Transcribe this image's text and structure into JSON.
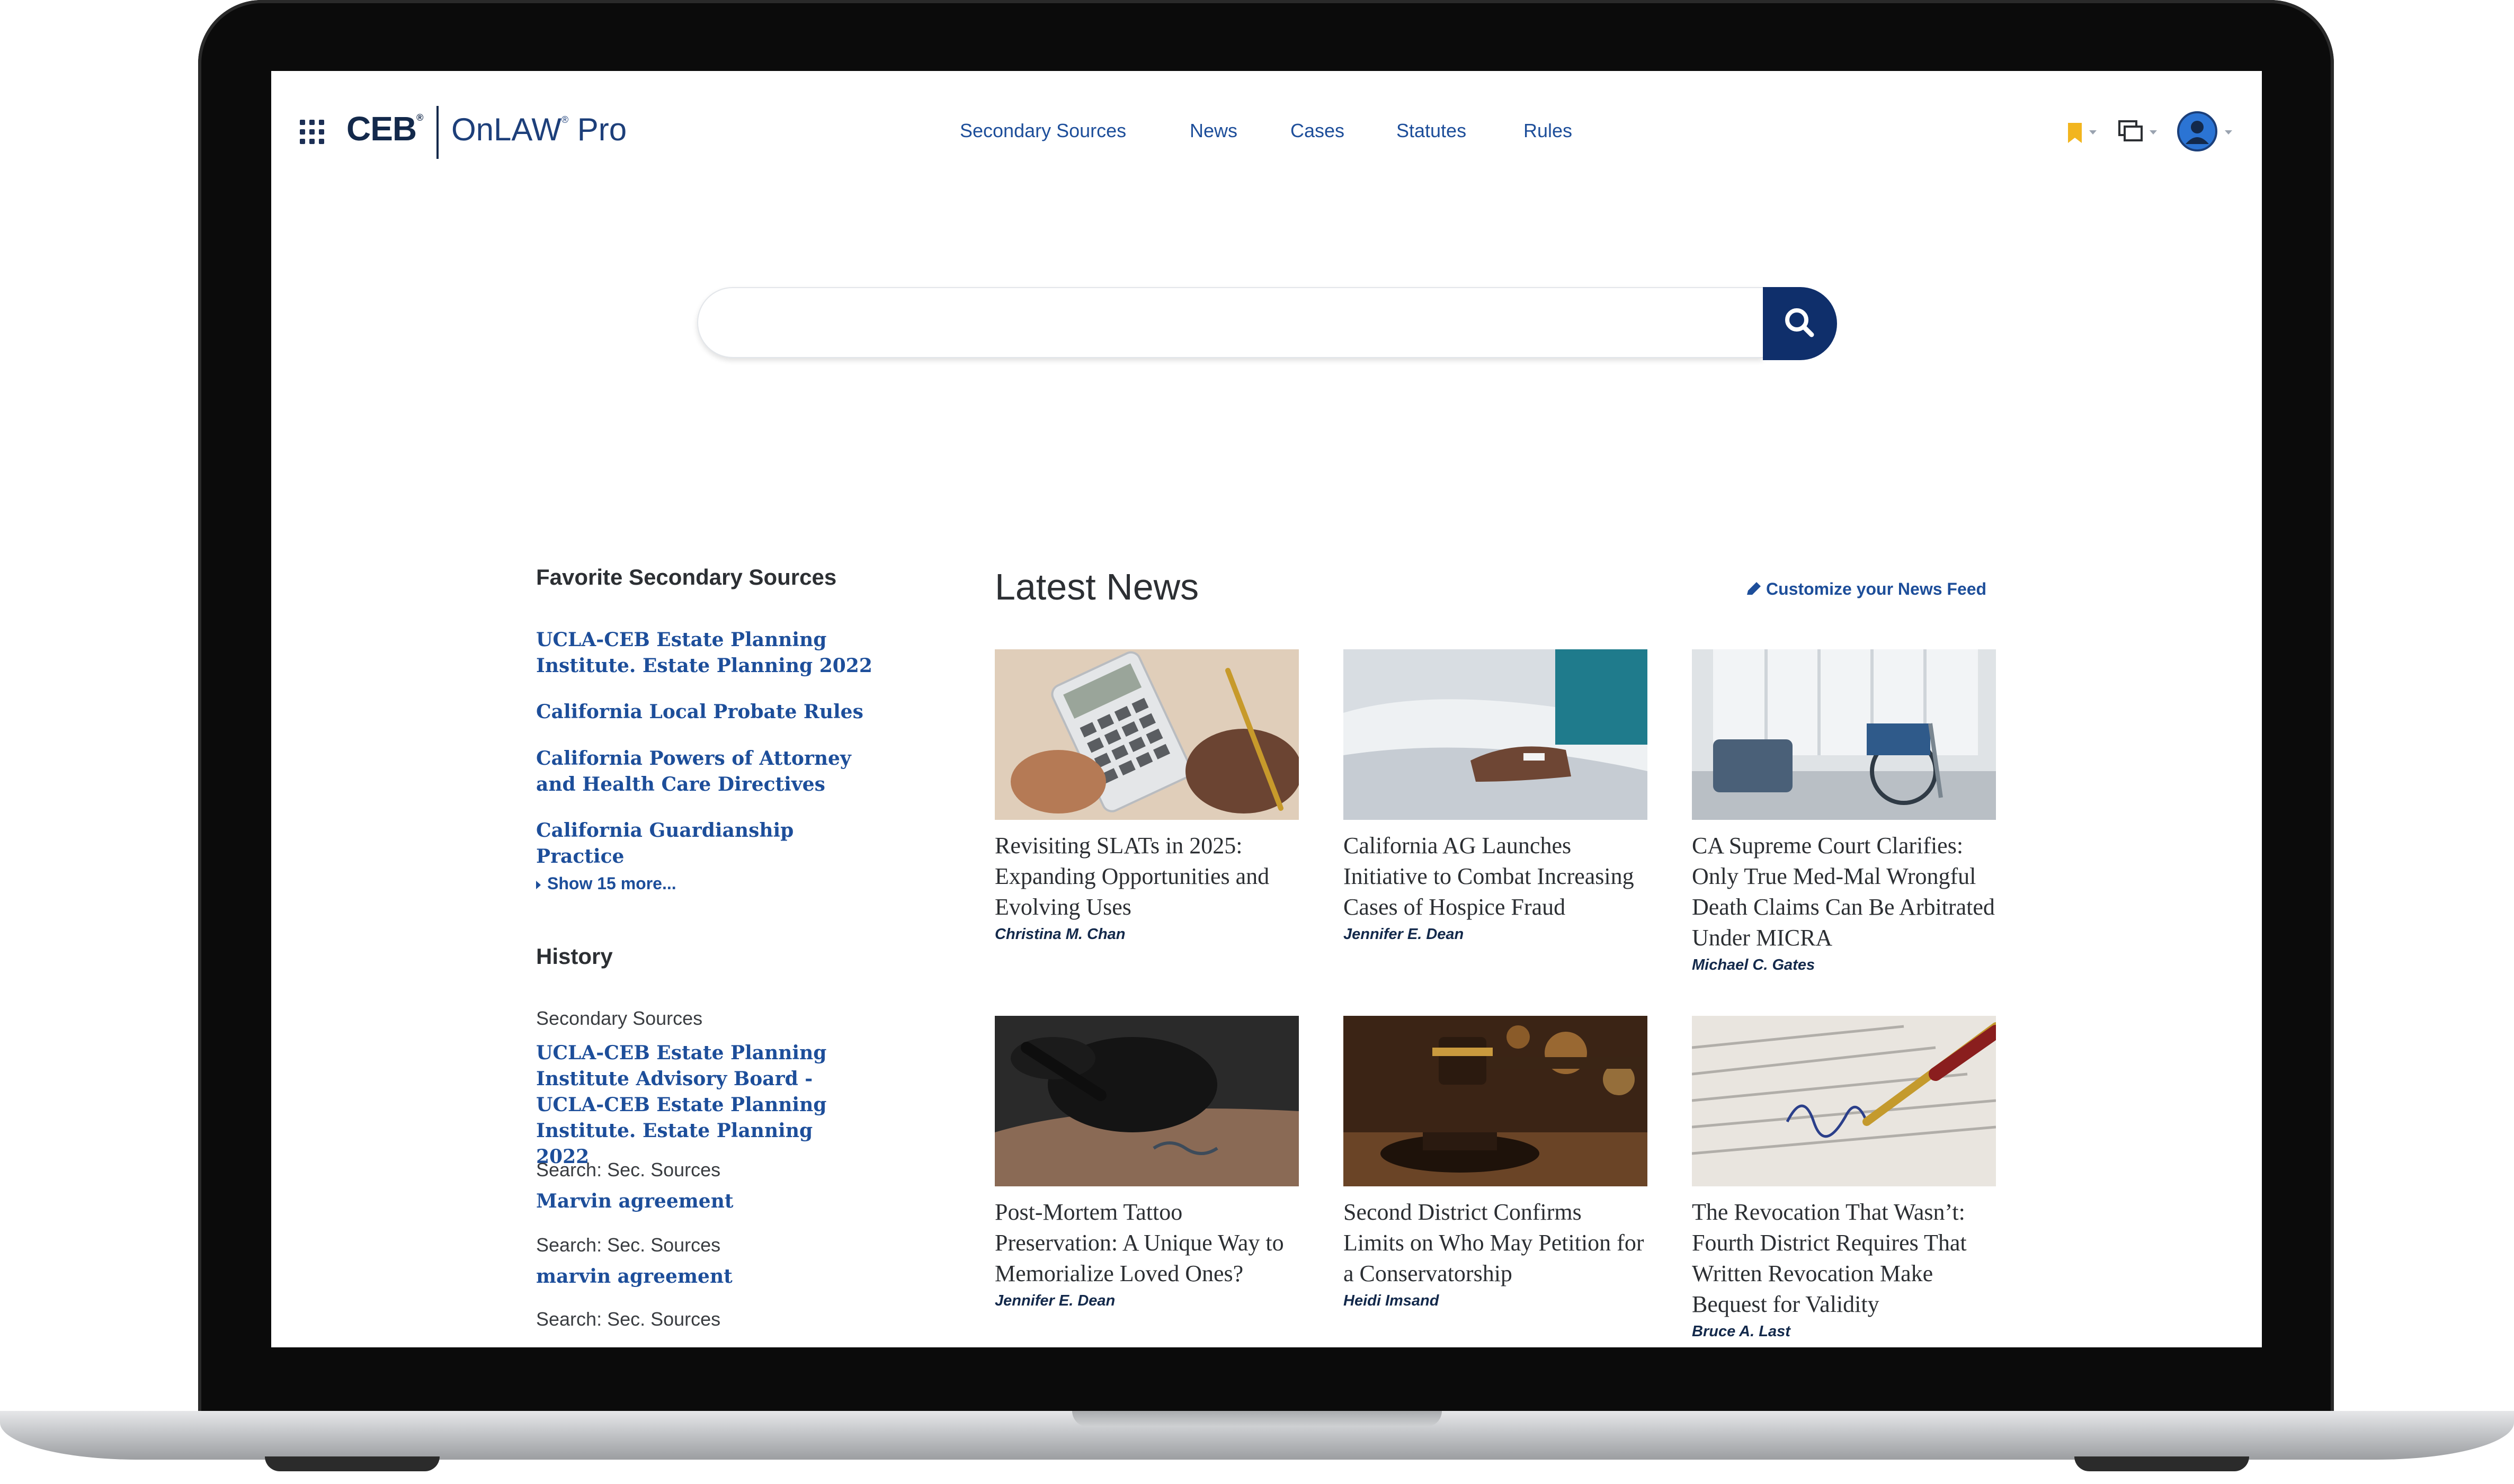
{
  "brand": {
    "ceb": "CEB",
    "product": "OnLAW",
    "tier": "Pro",
    "mark": "®"
  },
  "nav": [
    {
      "label": "Secondary Sources"
    },
    {
      "label": "News"
    },
    {
      "label": "Cases"
    },
    {
      "label": "Statutes"
    },
    {
      "label": "Rules"
    }
  ],
  "header_icons": [
    "bookmark-icon",
    "documents-icon",
    "account-avatar-icon"
  ],
  "colors": {
    "brand_navy": "#13294b",
    "link_blue": "#1d4e9a",
    "search_button": "#0f2f6b",
    "bookmark_yellow": "#f2b51e"
  },
  "search": {
    "placeholder": ""
  },
  "sidebar": {
    "favorites_heading": "Favorite Secondary Sources",
    "favorites": [
      {
        "label": "UCLA-CEB Estate Planning Institute. Estate Planning 2022"
      },
      {
        "label": "California Local Probate Rules"
      },
      {
        "label": "California Powers of Attorney and Health Care Directives"
      },
      {
        "label": "California Guardianship Practice"
      }
    ],
    "show_more": "Show 15 more...",
    "history_heading": "History",
    "history": [
      {
        "type": "Secondary Sources",
        "label": "UCLA-CEB Estate Planning Institute Advisory Board - UCLA-CEB Estate Planning Institute. Estate Planning 2022"
      },
      {
        "type": "Search: Sec. Sources",
        "label": "Marvin agreement"
      },
      {
        "type": "Search: Sec. Sources",
        "label": "marvin agreement"
      },
      {
        "type": "Search: Sec. Sources",
        "label": ""
      }
    ]
  },
  "news": {
    "heading": "Latest News",
    "customize": "Customize your News Feed",
    "articles": [
      {
        "title": "Revisiting SLATs in 2025: Expanding Opportunities and Evolving Uses",
        "author": "Christina M. Chan",
        "image": "calculator-photo"
      },
      {
        "title": "California AG Launches Initiative to Combat Increasing Cases of Hospice Fraud",
        "author": "Jennifer E. Dean",
        "image": "hospital-patient-photo"
      },
      {
        "title": "CA Supreme Court Clarifies: Only True Med-Mal Wrongful Death Claims Can Be Arbitrated Under MICRA",
        "author": "Michael C. Gates",
        "image": "wheelchair-room-photo"
      },
      {
        "title": "Post-Mortem Tattoo Preservation: A Unique Way to Memorialize Loved Ones?",
        "author": "Jennifer E. Dean",
        "image": "tattoo-artist-photo"
      },
      {
        "title": "Second District Confirms Limits on Who May Petition for a Conservatorship",
        "author": "Heidi Imsand",
        "image": "gavel-photo"
      },
      {
        "title": "The Revocation That Wasn’t: Fourth District Requires That Written Revocation Make Bequest for Validity",
        "author": "Bruce A. Last",
        "image": "signing-document-photo"
      }
    ]
  }
}
